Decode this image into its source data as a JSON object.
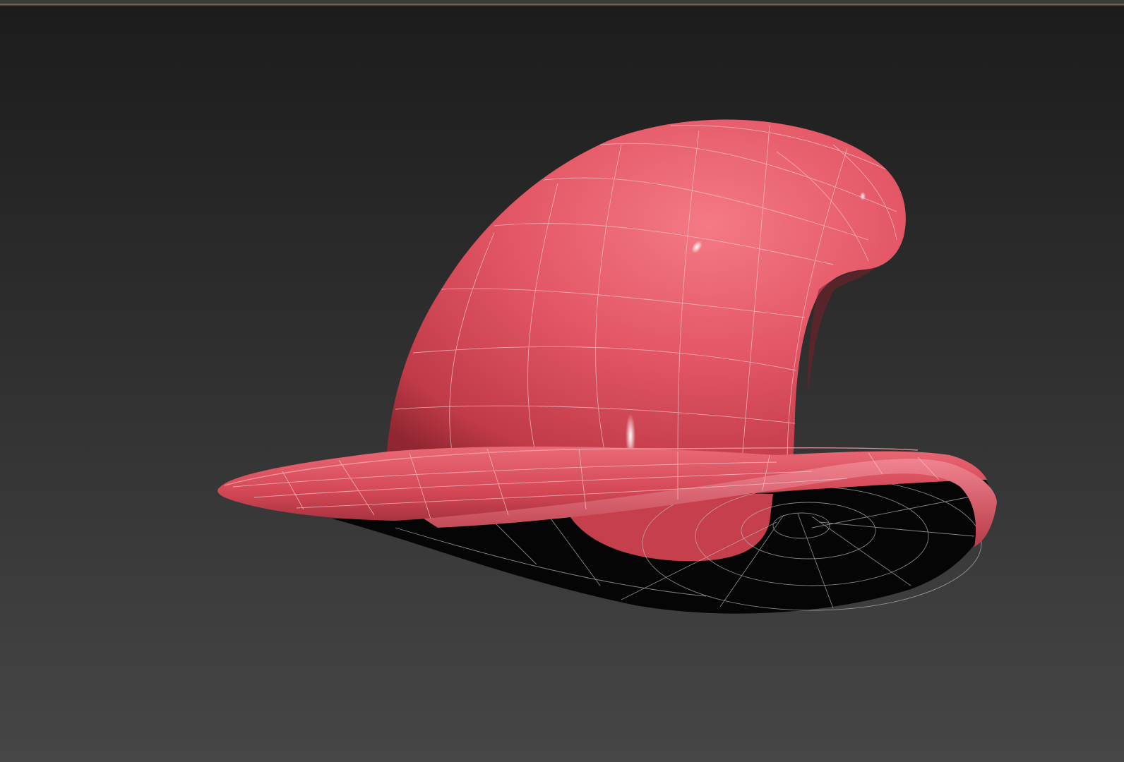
{
  "viewport": {
    "background_top": "#1c1c1c",
    "background_bottom": "#464646",
    "top_border_accent": "#8a7a52"
  },
  "model": {
    "object": "witch-hat",
    "display_mode": "shaded-with-wireframe",
    "base_color": "#e0505e",
    "highlight_color": "#f27682",
    "shadow_color": "#9a2a34",
    "interior_color": "#000000",
    "wire_color": "#d9a8ad"
  }
}
